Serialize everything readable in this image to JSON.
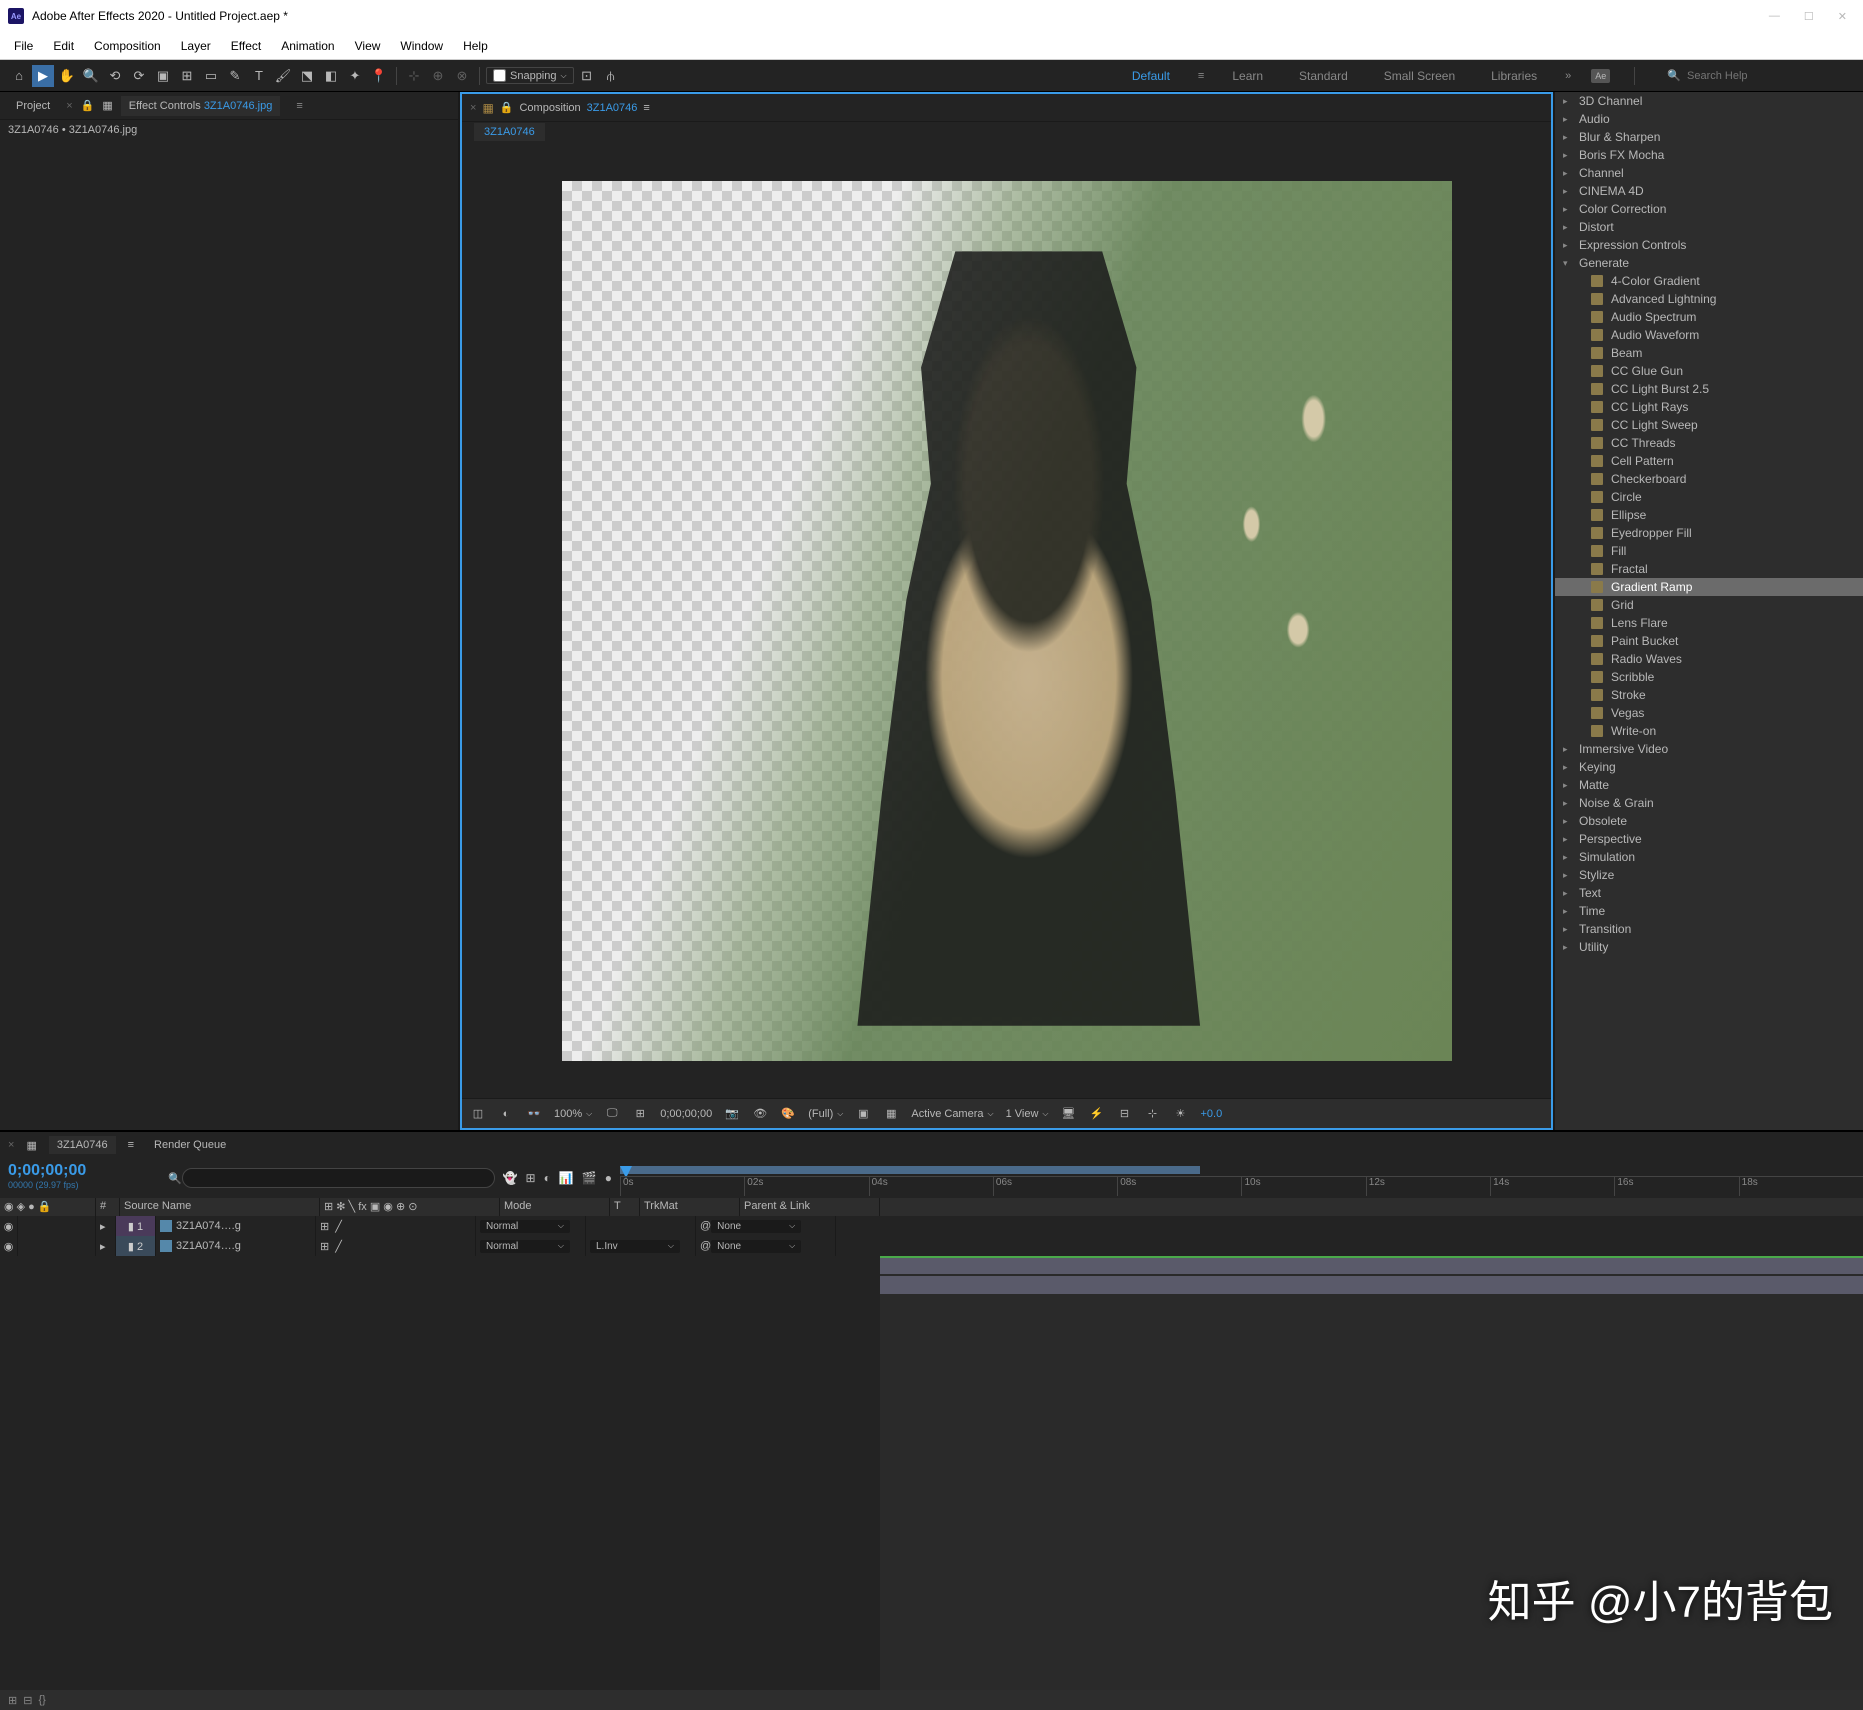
{
  "titlebar": {
    "app": "Adobe After Effects 2020 - Untitled Project.aep *"
  },
  "menu": [
    "File",
    "Edit",
    "Composition",
    "Layer",
    "Effect",
    "Animation",
    "View",
    "Window",
    "Help"
  ],
  "toolbar": {
    "snapping": "Snapping"
  },
  "workspaces": {
    "default": "Default",
    "learn": "Learn",
    "standard": "Standard",
    "small": "Small Screen",
    "libraries": "Libraries"
  },
  "search": {
    "placeholder": "Search Help"
  },
  "projectPanel": {
    "tab1": "Project",
    "tab2": "Effect Controls",
    "tab2link": "3Z1A0746.jpg",
    "breadcrumb": "3Z1A0746 • 3Z1A0746.jpg"
  },
  "compPanel": {
    "label": "Composition",
    "name": "3Z1A0746",
    "subtab": "3Z1A0746"
  },
  "viewerFooter": {
    "zoom": "100%",
    "time": "0;00;00;00",
    "res": "(Full)",
    "camera": "Active Camera",
    "view": "1 View",
    "exposure": "+0.0"
  },
  "effectsCategories": [
    "3D Channel",
    "Audio",
    "Blur & Sharpen",
    "Boris FX Mocha",
    "Channel",
    "CINEMA 4D",
    "Color Correction",
    "Distort",
    "Expression Controls"
  ],
  "generateLabel": "Generate",
  "generateItems": [
    "4-Color Gradient",
    "Advanced Lightning",
    "Audio Spectrum",
    "Audio Waveform",
    "Beam",
    "CC Glue Gun",
    "CC Light Burst 2.5",
    "CC Light Rays",
    "CC Light Sweep",
    "CC Threads",
    "Cell Pattern",
    "Checkerboard",
    "Circle",
    "Ellipse",
    "Eyedropper Fill",
    "Fill",
    "Fractal",
    "Gradient Ramp",
    "Grid",
    "Lens Flare",
    "Paint Bucket",
    "Radio Waves",
    "Scribble",
    "Stroke",
    "Vegas",
    "Write-on"
  ],
  "highlightedEffect": "Gradient Ramp",
  "effectsCategoriesAfter": [
    "Immersive Video",
    "Keying",
    "Matte",
    "Noise & Grain",
    "Obsolete",
    "Perspective",
    "Simulation",
    "Stylize",
    "Text",
    "Time",
    "Transition",
    "Utility"
  ],
  "timeline": {
    "tab": "3Z1A0746",
    "renderQueue": "Render Queue",
    "timecode": "0;00;00;00",
    "timecodeSub": "00000 (29.97 fps)",
    "cols": {
      "num": "#",
      "source": "Source Name",
      "mode": "Mode",
      "t": "T",
      "trkmat": "TrkMat",
      "parent": "Parent & Link"
    },
    "ticks": [
      "0s",
      "02s",
      "04s",
      "06s",
      "08s",
      "10s",
      "12s",
      "14s",
      "16s",
      "18s"
    ],
    "layers": [
      {
        "num": "1",
        "name": "3Z1A074….g",
        "mode": "Normal",
        "trkmat": "",
        "parent": "None"
      },
      {
        "num": "2",
        "name": "3Z1A074….g",
        "mode": "Normal",
        "trkmat": "L.Inv",
        "parent": "None"
      }
    ]
  },
  "watermark": "知乎 @小7的背包"
}
